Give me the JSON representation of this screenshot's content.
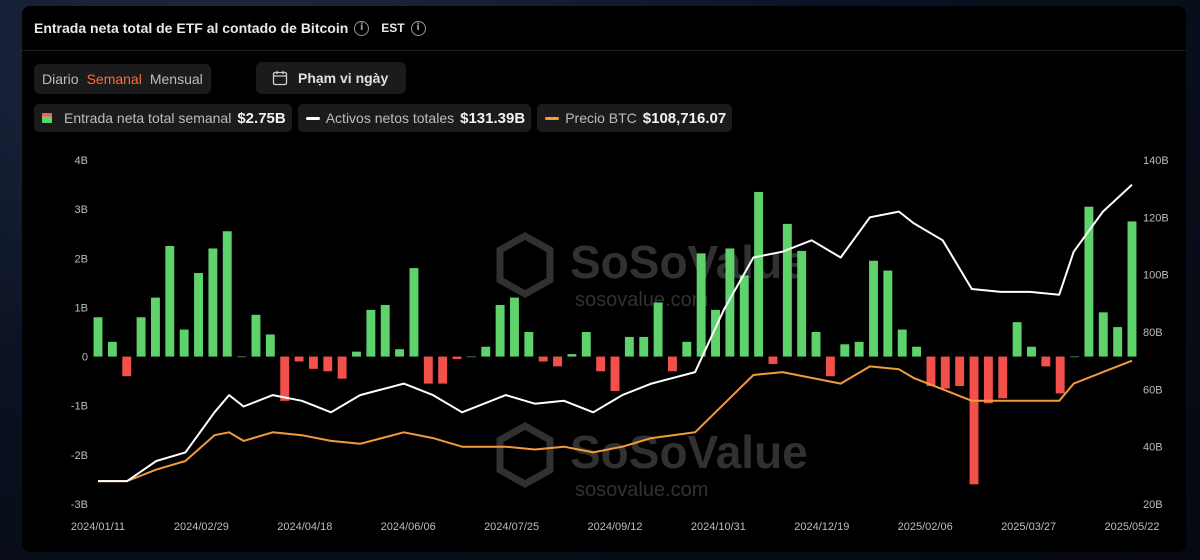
{
  "header": {
    "title": "Entrada neta total de ETF al contado de Bitcoin",
    "timezone": "EST"
  },
  "periods": [
    {
      "label": "Diario",
      "active": false
    },
    {
      "label": "Semanal",
      "active": true
    },
    {
      "label": "Mensual",
      "active": false
    }
  ],
  "range_button": {
    "label": "Phạm vi ngày",
    "icon": "calendar-icon"
  },
  "legend": [
    {
      "label": "Entrada neta total semanal",
      "value": "$2.75B",
      "kind": "bar"
    },
    {
      "label": "Activos netos totales",
      "value": "$131.39B",
      "kind": "line",
      "color": "#ffffff"
    },
    {
      "label": "Precio BTC",
      "value": "$108,716.07",
      "kind": "line",
      "color": "#f39a3c"
    }
  ],
  "watermark": {
    "brand": "SoSoValue",
    "url": "sosovalue.com"
  },
  "colors": {
    "positive": "#5fd36b",
    "negative": "#f2504b",
    "assets_line": "#ffffff",
    "price_line": "#f39a3c"
  },
  "chart_data": {
    "type": "bar",
    "title": "Entrada neta total de ETF al contado de Bitcoin",
    "y_left": {
      "ticks": [
        "4B",
        "3B",
        "2B",
        "1B",
        "0",
        "-1B",
        "-2B",
        "-3B"
      ],
      "range": [
        -3,
        4
      ],
      "unit": "B USD"
    },
    "y_right": {
      "ticks": [
        "140B",
        "120B",
        "100B",
        "80B",
        "60B",
        "40B",
        "20B"
      ],
      "range": [
        20,
        140
      ],
      "unit": "B USD"
    },
    "x_tick_labels": [
      "2024/01/11",
      "2024/02/29",
      "2024/04/18",
      "2024/06/06",
      "2024/07/25",
      "2024/09/12",
      "2024/10/31",
      "2024/12/19",
      "2025/02/06",
      "2025/03/27",
      "2025/05/22"
    ],
    "x_start": "2024/01/11",
    "x_end": "2025/05/22",
    "series": [
      {
        "name": "Entrada neta total semanal",
        "kind": "bar",
        "values": [
          0.8,
          0.3,
          -0.4,
          0.8,
          1.2,
          2.25,
          0.55,
          1.7,
          2.2,
          2.55,
          0,
          0.85,
          0.45,
          -0.9,
          -0.1,
          -0.25,
          -0.3,
          -0.45,
          0.1,
          0.95,
          1.05,
          0.15,
          1.8,
          -0.55,
          -0.55,
          -0.05,
          0,
          0.2,
          1.05,
          1.2,
          0.5,
          -0.1,
          -0.2,
          0.05,
          0.5,
          -0.3,
          -0.7,
          0.4,
          0.4,
          1.1,
          -0.3,
          0.3,
          2.1,
          0.95,
          2.2,
          1.65,
          3.35,
          -0.15,
          2.7,
          2.15,
          0.5,
          -0.4,
          0.25,
          0.3,
          1.95,
          1.75,
          0.55,
          0.2,
          -0.6,
          -0.65,
          -0.6,
          -2.6,
          -0.95,
          -0.85,
          0.7,
          0.2,
          -0.2,
          -0.75,
          0,
          3.05,
          0.9,
          0.6,
          2.75
        ]
      },
      {
        "name": "Activos netos totales",
        "kind": "line",
        "points": [
          [
            "2024/01/11",
            28
          ],
          [
            "2024/01/25",
            28
          ],
          [
            "2024/02/08",
            35
          ],
          [
            "2024/02/22",
            38
          ],
          [
            "2024/03/07",
            52
          ],
          [
            "2024/03/14",
            58
          ],
          [
            "2024/03/21",
            54
          ],
          [
            "2024/04/04",
            58
          ],
          [
            "2024/04/18",
            56
          ],
          [
            "2024/05/02",
            52
          ],
          [
            "2024/05/16",
            58
          ],
          [
            "2024/06/06",
            62
          ],
          [
            "2024/06/20",
            58
          ],
          [
            "2024/07/04",
            52
          ],
          [
            "2024/07/25",
            58
          ],
          [
            "2024/08/08",
            55
          ],
          [
            "2024/08/22",
            56
          ],
          [
            "2024/09/05",
            52
          ],
          [
            "2024/09/19",
            58
          ],
          [
            "2024/10/03",
            62
          ],
          [
            "2024/10/24",
            66
          ],
          [
            "2024/11/07",
            88
          ],
          [
            "2024/11/21",
            106
          ],
          [
            "2024/12/05",
            108
          ],
          [
            "2024/12/19",
            112
          ],
          [
            "2025/01/02",
            106
          ],
          [
            "2025/01/16",
            120
          ],
          [
            "2025/01/30",
            122
          ],
          [
            "2025/02/06",
            118
          ],
          [
            "2025/02/20",
            112
          ],
          [
            "2025/03/06",
            95
          ],
          [
            "2025/03/20",
            94
          ],
          [
            "2025/04/03",
            94
          ],
          [
            "2025/04/17",
            93
          ],
          [
            "2025/04/24",
            108
          ],
          [
            "2025/05/08",
            122
          ],
          [
            "2025/05/22",
            131.39
          ]
        ]
      },
      {
        "name": "Precio BTC",
        "kind": "line",
        "points": [
          [
            "2024/01/11",
            28
          ],
          [
            "2024/01/25",
            28
          ],
          [
            "2024/02/08",
            32
          ],
          [
            "2024/02/22",
            35
          ],
          [
            "2024/03/07",
            44
          ],
          [
            "2024/03/14",
            45
          ],
          [
            "2024/03/21",
            42
          ],
          [
            "2024/04/04",
            45
          ],
          [
            "2024/04/18",
            44
          ],
          [
            "2024/05/02",
            42
          ],
          [
            "2024/05/16",
            41
          ],
          [
            "2024/06/06",
            45
          ],
          [
            "2024/06/20",
            43
          ],
          [
            "2024/07/04",
            40
          ],
          [
            "2024/07/25",
            40
          ],
          [
            "2024/08/08",
            39
          ],
          [
            "2024/08/22",
            40
          ],
          [
            "2024/09/05",
            38
          ],
          [
            "2024/09/19",
            40
          ],
          [
            "2024/10/03",
            43
          ],
          [
            "2024/10/24",
            45
          ],
          [
            "2024/11/07",
            55
          ],
          [
            "2024/11/21",
            65
          ],
          [
            "2024/12/05",
            66
          ],
          [
            "2024/12/19",
            64
          ],
          [
            "2025/01/02",
            62
          ],
          [
            "2025/01/16",
            68
          ],
          [
            "2025/01/30",
            67
          ],
          [
            "2025/02/06",
            64
          ],
          [
            "2025/02/20",
            60
          ],
          [
            "2025/03/06",
            56
          ],
          [
            "2025/03/20",
            56
          ],
          [
            "2025/04/03",
            56
          ],
          [
            "2025/04/17",
            56
          ],
          [
            "2025/04/24",
            62
          ],
          [
            "2025/05/08",
            66
          ],
          [
            "2025/05/22",
            70
          ]
        ]
      }
    ],
    "legend_position": "top-left",
    "grid": false
  }
}
